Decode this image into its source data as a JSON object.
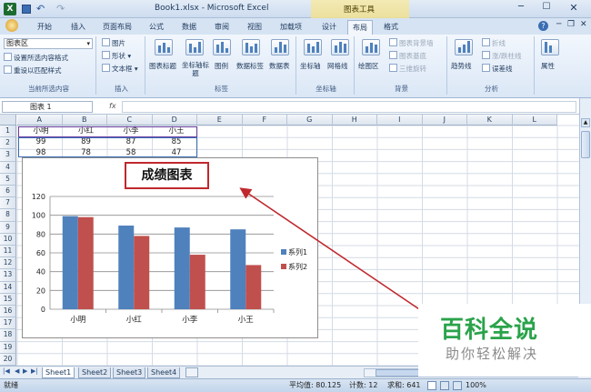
{
  "window": {
    "title": "Book1.xlsx - Microsoft Excel",
    "context_tab": "图表工具"
  },
  "ribbon_tabs": [
    "开始",
    "插入",
    "页面布局",
    "公式",
    "数据",
    "审阅",
    "视图",
    "加载项",
    "设计",
    "布局",
    "格式"
  ],
  "ribbon": {
    "current_selection": {
      "dropdown": "图表区",
      "format_selection": "设置所选内容格式",
      "reset_style": "重设以匹配样式",
      "label": "当前所选内容"
    },
    "insert": {
      "picture": "图片",
      "shapes": "形状",
      "textbox": "文本框",
      "label": "插入"
    },
    "labels": {
      "chart_title": "图表标题",
      "axis_title": "坐标轴标题",
      "legend": "图例",
      "data_labels": "数据标签",
      "data_table": "数据表",
      "label": "标签"
    },
    "axes": {
      "axes": "坐标轴",
      "gridlines": "网格线",
      "label": "坐标轴"
    },
    "background": {
      "plot_area": "绘图区",
      "chart_wall": "图表背景墙",
      "chart_floor": "图表基底",
      "rotation": "三维旋转",
      "label": "背景"
    },
    "analysis": {
      "trendline": "趋势线",
      "lines": "折线",
      "updown": "涨/跌柱线",
      "errorbars": "误差线",
      "label": "分析"
    },
    "properties": {
      "label": "属性"
    }
  },
  "formula_bar": {
    "name_box": "图表 1",
    "fx": "fx"
  },
  "columns": [
    "A",
    "B",
    "C",
    "D",
    "E",
    "F",
    "G",
    "H",
    "I",
    "J",
    "K",
    "L"
  ],
  "rows": [
    "1",
    "2",
    "3",
    "4",
    "5",
    "6",
    "7",
    "8",
    "9",
    "10",
    "11",
    "12",
    "13",
    "14",
    "15",
    "16",
    "17",
    "18",
    "19",
    "20"
  ],
  "cells": {
    "row1": [
      "小明",
      "小红",
      "小李",
      "小王"
    ],
    "row2": [
      "99",
      "89",
      "87",
      "85"
    ],
    "row3": [
      "98",
      "78",
      "58",
      "47"
    ]
  },
  "chart_data": {
    "type": "bar",
    "title": "成绩图表",
    "categories": [
      "小明",
      "小红",
      "小李",
      "小王"
    ],
    "series": [
      {
        "name": "系列1",
        "values": [
          99,
          89,
          87,
          85
        ],
        "color": "#4f81bd"
      },
      {
        "name": "系列2",
        "values": [
          98,
          78,
          58,
          47
        ],
        "color": "#c0504d"
      }
    ],
    "ylim": [
      0,
      120
    ],
    "yticks": [
      "0",
      "20",
      "40",
      "60",
      "80",
      "100",
      "120"
    ],
    "grid": true,
    "legend": "right"
  },
  "sheets": [
    "Sheet1",
    "Sheet2",
    "Sheet3",
    "Sheet4"
  ],
  "status": {
    "ready": "就绪",
    "average": "平均值: 80.125",
    "count": "计数: 12",
    "sum": "求和: 641",
    "zoom": "100%"
  },
  "watermark": {
    "title": "百科全说",
    "subtitle": "助你轻松解决"
  }
}
